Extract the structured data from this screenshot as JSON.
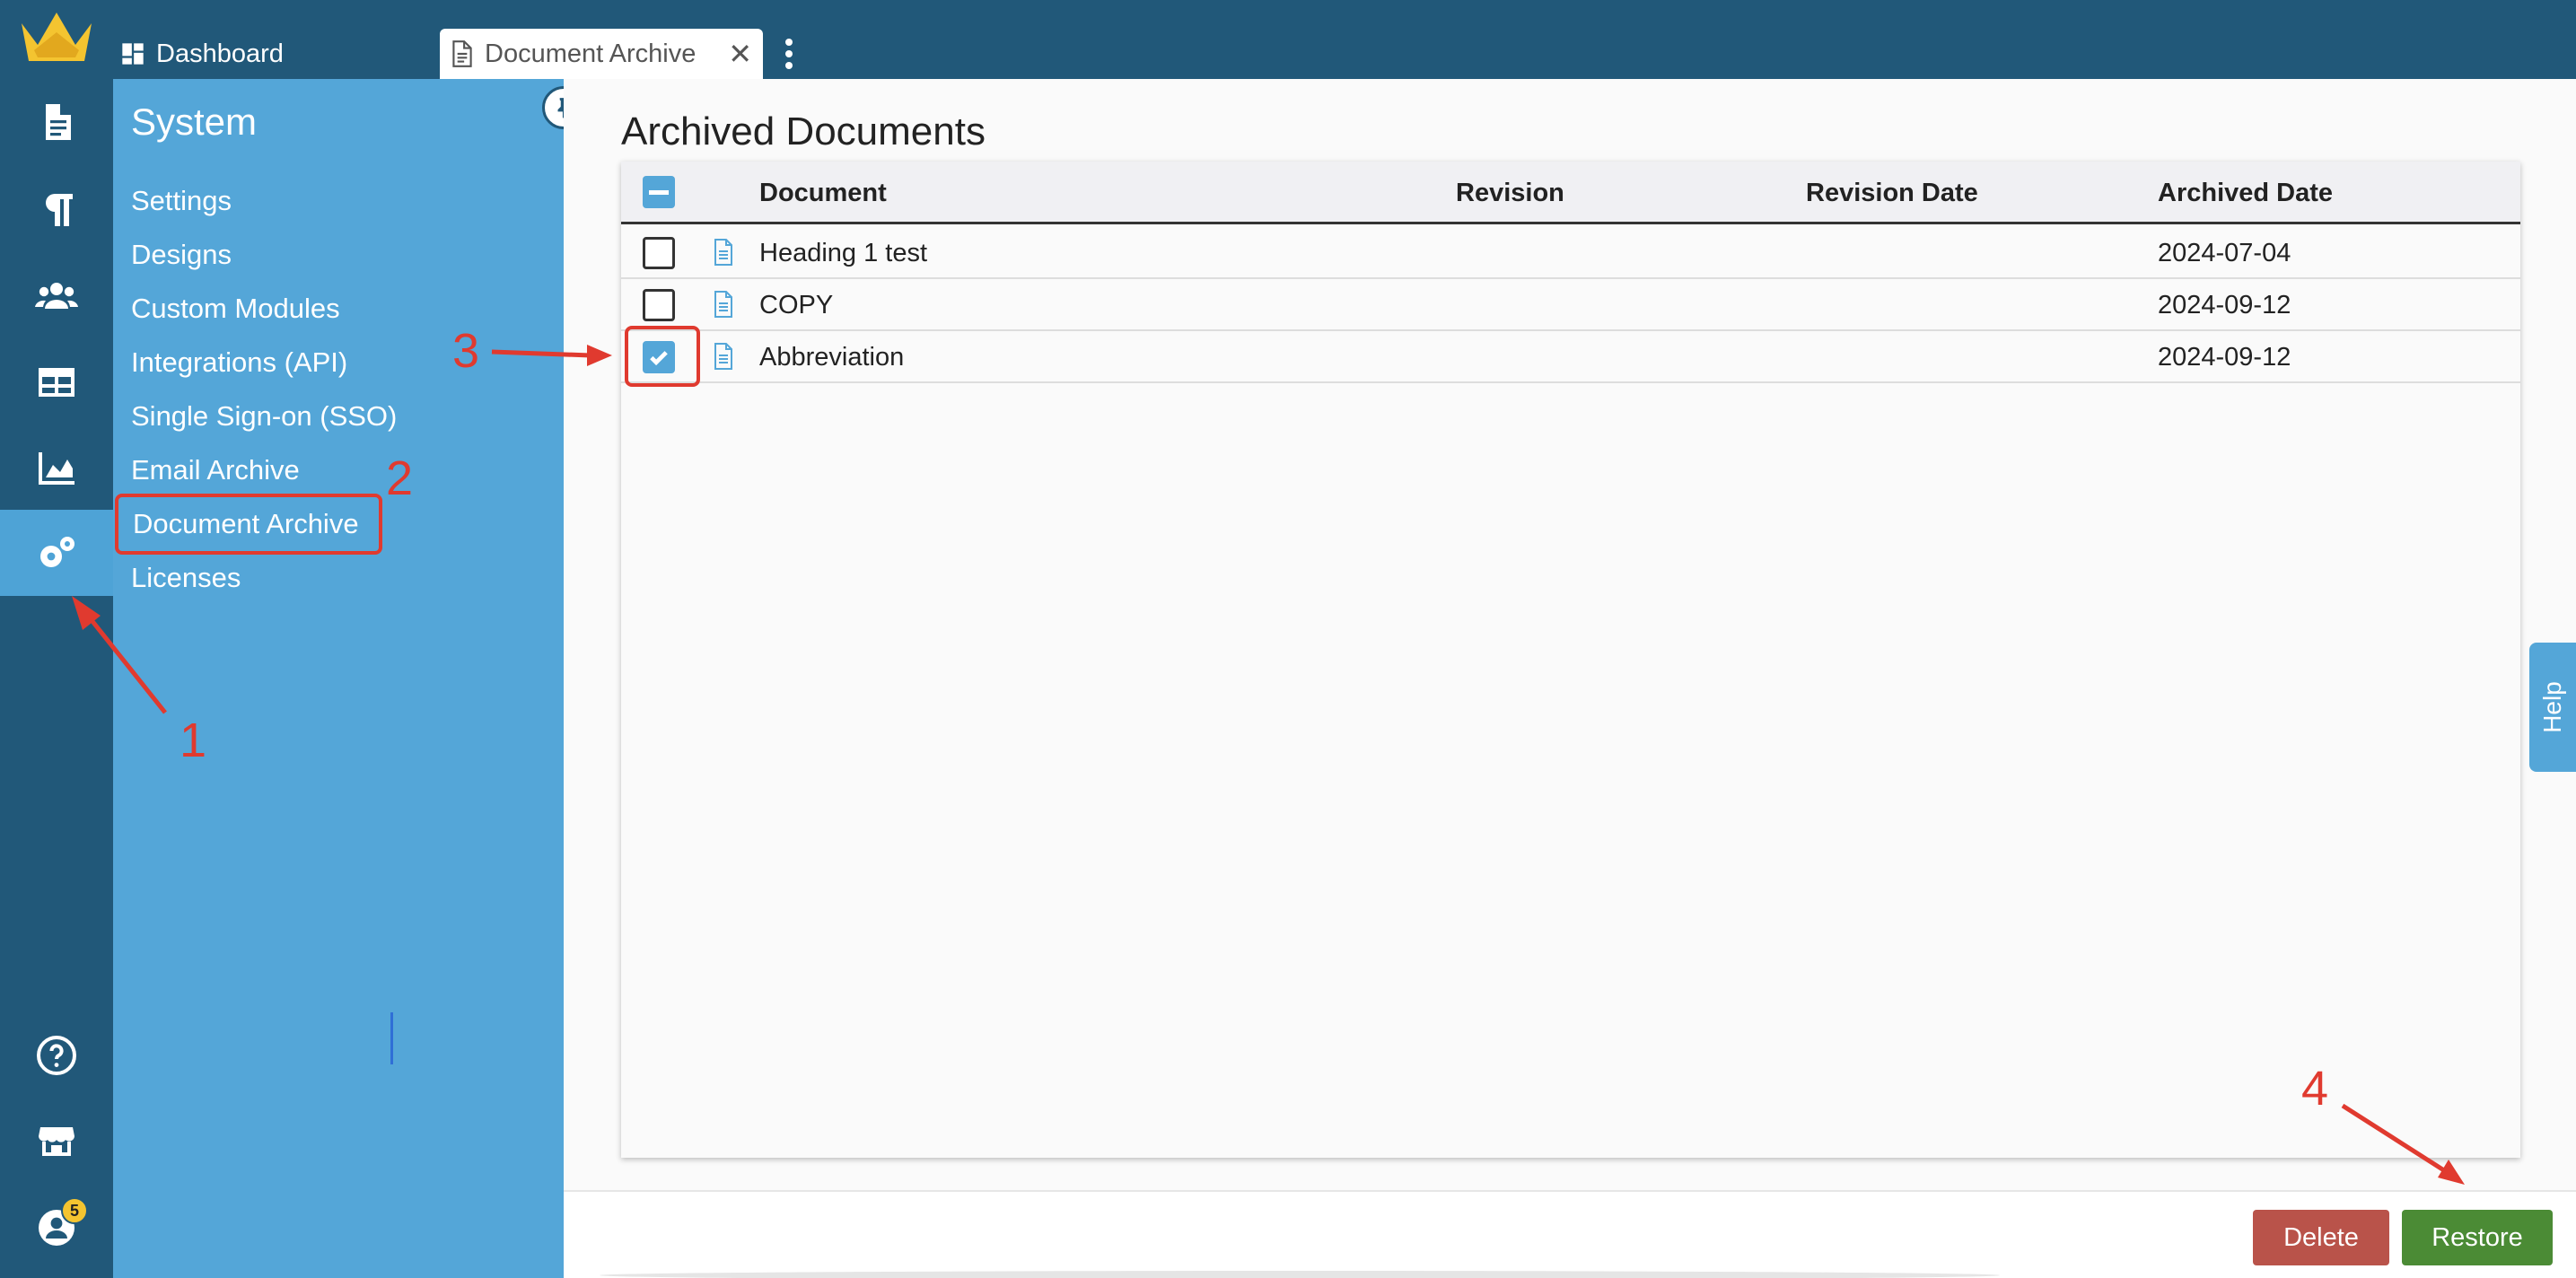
{
  "tabs": {
    "dashboard_label": "Dashboard",
    "document_archive_label": "Document Archive",
    "close_glyph": "✕"
  },
  "rail": {
    "notification_count": "5",
    "icons": [
      "crown-logo-icon",
      "document-icon",
      "paragraph-icon",
      "users-icon",
      "table-icon",
      "chart-icon",
      "settings-icon",
      "help-icon",
      "store-icon",
      "account-icon"
    ]
  },
  "sidebar": {
    "title": "System",
    "items": [
      {
        "label": "Settings"
      },
      {
        "label": "Designs"
      },
      {
        "label": "Custom Modules"
      },
      {
        "label": "Integrations (API)"
      },
      {
        "label": "Single Sign-on (SSO)"
      },
      {
        "label": "Email Archive"
      },
      {
        "label": "Document Archive",
        "selected": true
      },
      {
        "label": "Licenses"
      }
    ]
  },
  "main": {
    "title": "Archived Documents",
    "columns": {
      "document": "Document",
      "revision": "Revision",
      "revision_date": "Revision Date",
      "archived_date": "Archived Date"
    },
    "rows": [
      {
        "document": "Heading 1 test",
        "revision": "",
        "revision_date": "",
        "archived_date": "2024-07-04",
        "checked": false
      },
      {
        "document": "COPY",
        "revision": "",
        "revision_date": "",
        "archived_date": "2024-09-12",
        "checked": false
      },
      {
        "document": "Abbreviation",
        "revision": "",
        "revision_date": "",
        "archived_date": "2024-09-12",
        "checked": true
      }
    ]
  },
  "footer": {
    "delete_label": "Delete",
    "restore_label": "Restore"
  },
  "help": {
    "label": "Help"
  },
  "annotations": {
    "step1": "1",
    "step2": "2",
    "step3": "3",
    "step4": "4"
  },
  "colors": {
    "rail_bg": "#215879",
    "sidebar_bg": "#54a6d8",
    "accent": "#54a6d8",
    "delete": "#b9534a",
    "restore": "#4b8b35",
    "annotation": "#e03a2f",
    "badge": "#f4c430"
  }
}
